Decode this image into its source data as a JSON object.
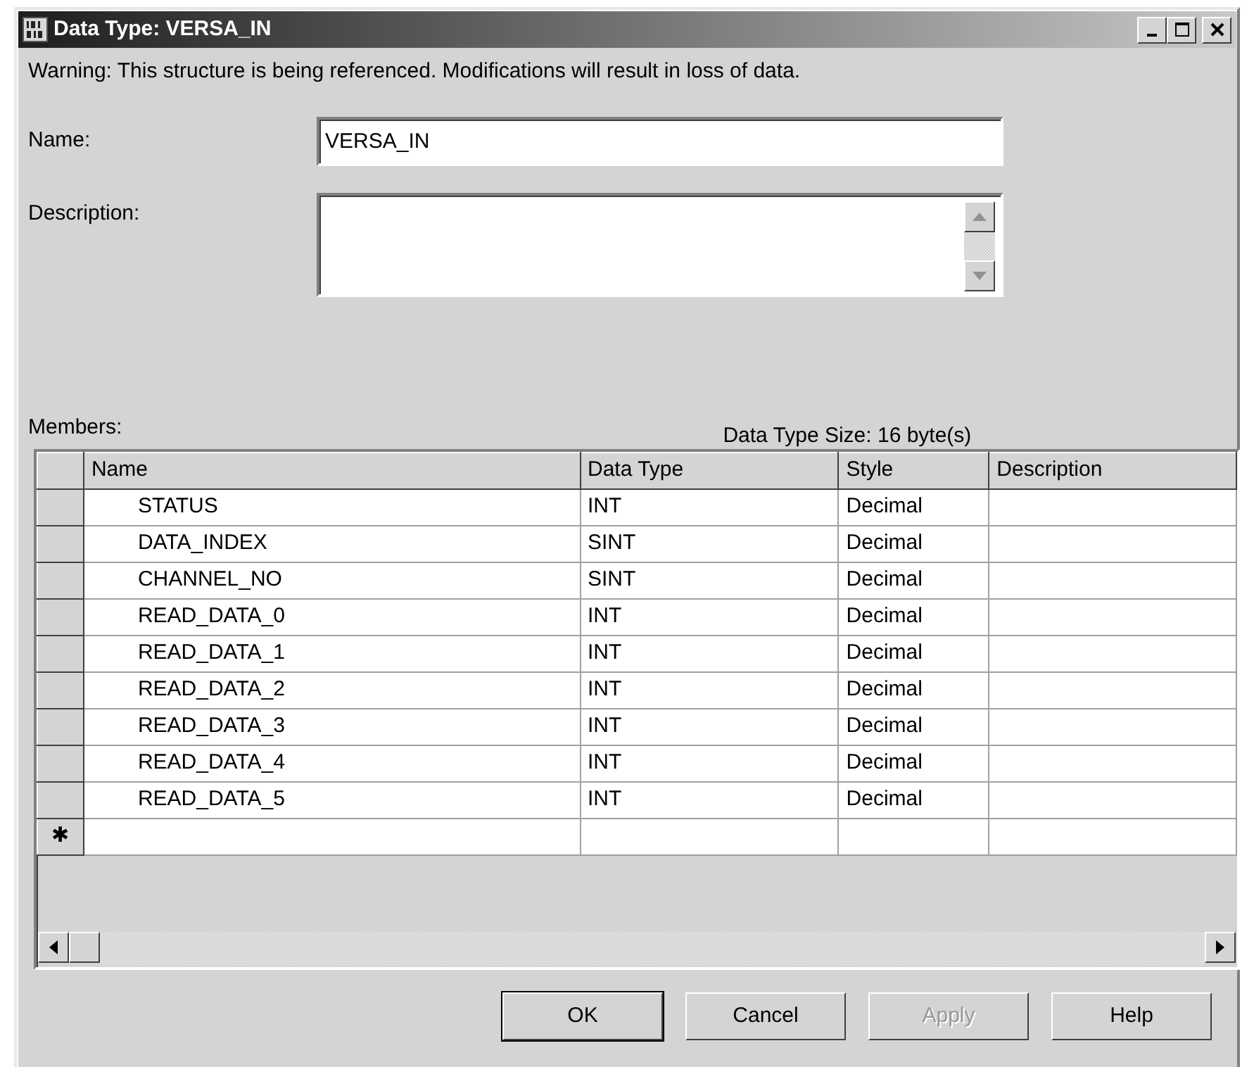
{
  "window": {
    "title": "Data Type: VERSA_IN"
  },
  "warning": "Warning: This structure is being referenced.  Modifications will result in loss of data.",
  "name_field": {
    "label": "Name:",
    "value": "VERSA_IN"
  },
  "description_field": {
    "label": "Description:"
  },
  "members": {
    "label": "Members:",
    "size_text": "Data Type Size: 16 byte(s)",
    "columns": [
      "Name",
      "Data Type",
      "Style",
      "Description"
    ],
    "rows": [
      {
        "name": "STATUS",
        "data_type": "INT",
        "style": "Decimal"
      },
      {
        "name": "DATA_INDEX",
        "data_type": "SINT",
        "style": "Decimal"
      },
      {
        "name": "CHANNEL_NO",
        "data_type": "SINT",
        "style": "Decimal"
      },
      {
        "name": "READ_DATA_0",
        "data_type": "INT",
        "style": "Decimal"
      },
      {
        "name": "READ_DATA_1",
        "data_type": "INT",
        "style": "Decimal"
      },
      {
        "name": "READ_DATA_2",
        "data_type": "INT",
        "style": "Decimal"
      },
      {
        "name": "READ_DATA_3",
        "data_type": "INT",
        "style": "Decimal"
      },
      {
        "name": "READ_DATA_4",
        "data_type": "INT",
        "style": "Decimal"
      },
      {
        "name": "READ_DATA_5",
        "data_type": "INT",
        "style": "Decimal"
      }
    ],
    "new_row_marker": "✱"
  },
  "buttons": [
    {
      "label": "OK",
      "default": true,
      "disabled": false
    },
    {
      "label": "Cancel",
      "default": false,
      "disabled": false
    },
    {
      "label": "Apply",
      "default": false,
      "disabled": true
    },
    {
      "label": "Help",
      "default": false,
      "disabled": false
    }
  ]
}
